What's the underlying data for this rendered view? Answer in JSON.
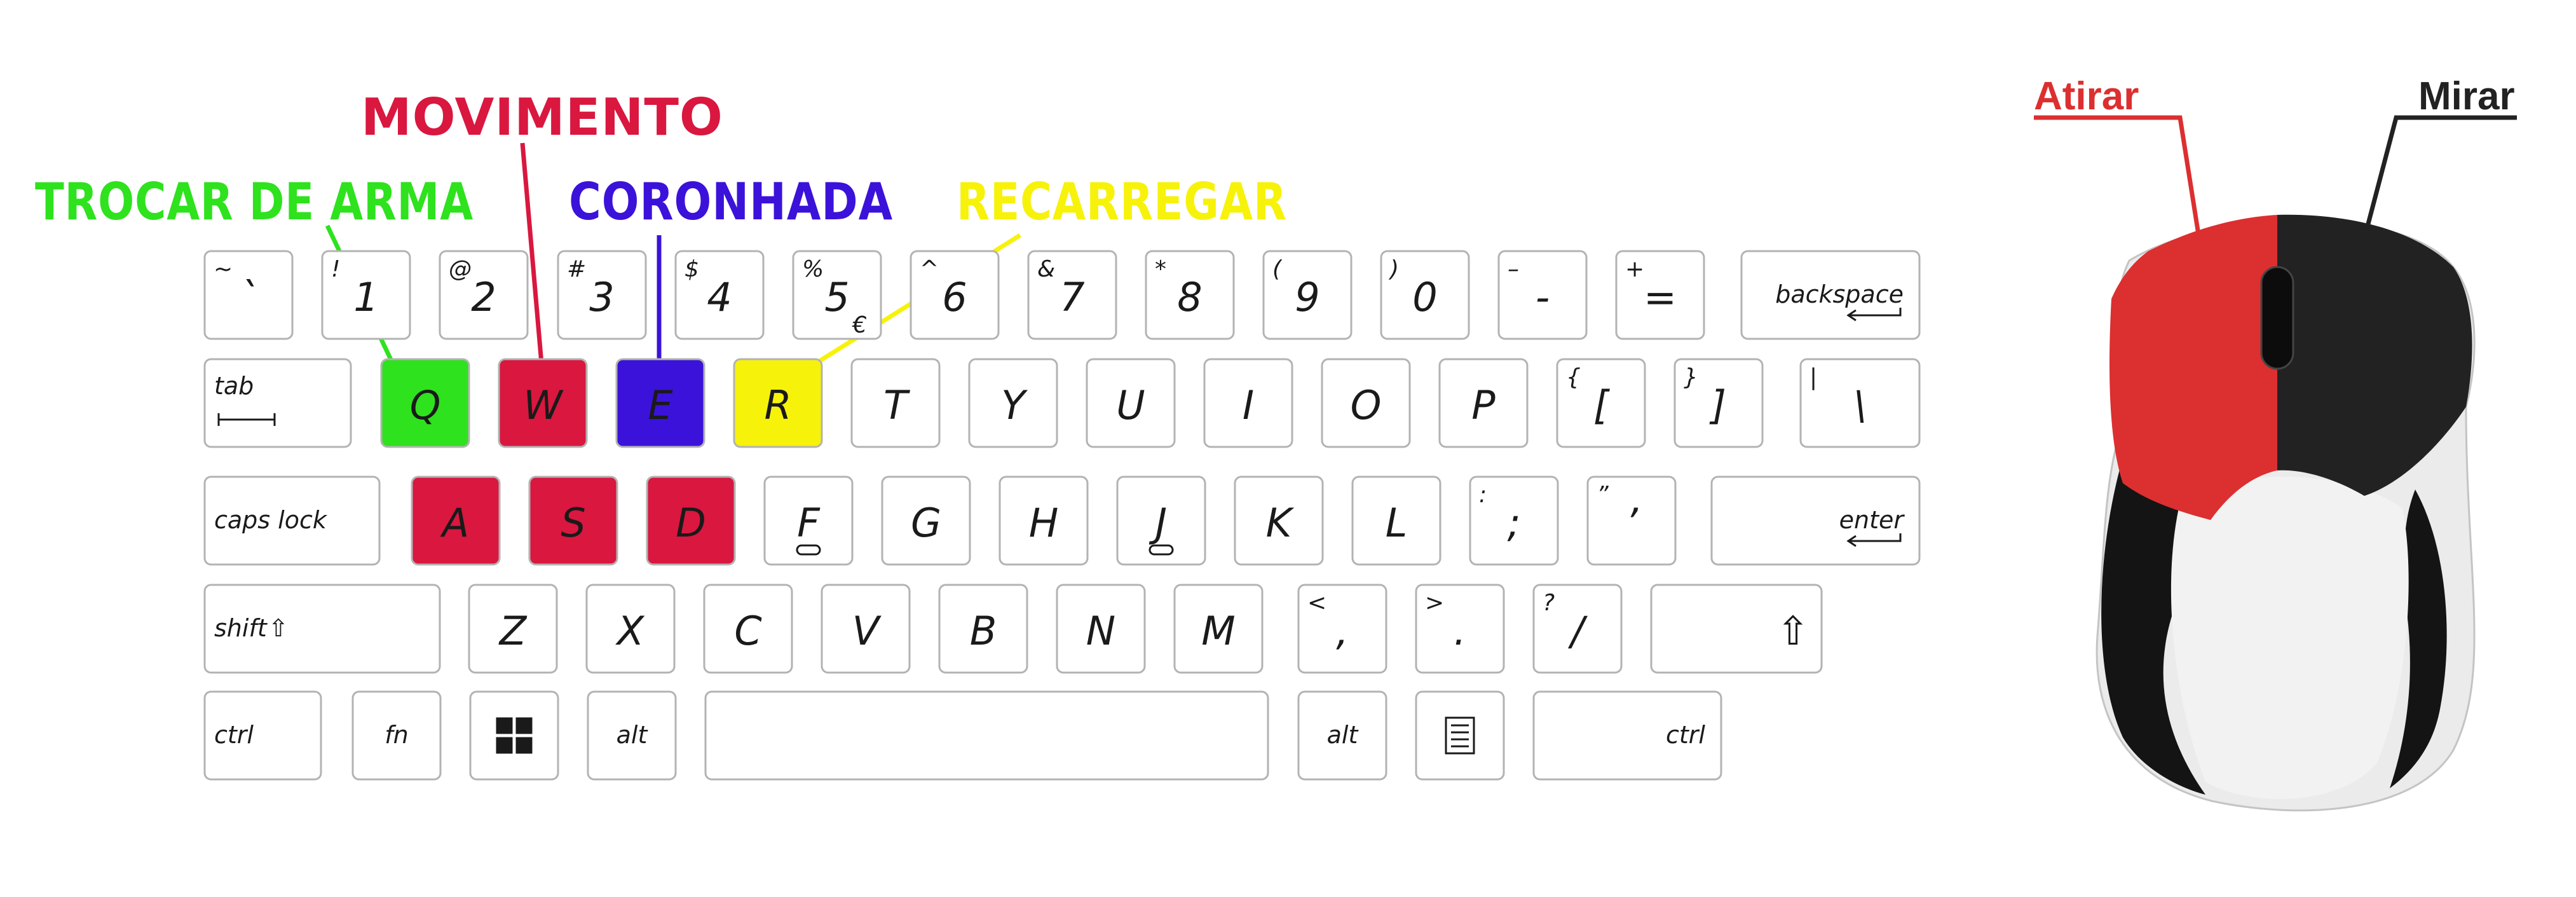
{
  "colors": {
    "green": "#2ee21e",
    "red": "#d9173f",
    "blue": "#3b12d9",
    "yellow": "#f7f20a",
    "mouse_red": "#dc2f30",
    "mouse_black": "#222222"
  },
  "callouts": {
    "movimento": "MOVIMENTO",
    "trocar_de_arma": "TROCAR DE ARMA",
    "coronhada": "CORONHADA",
    "recarregar": "RECARREGAR"
  },
  "mouse": {
    "left_button_label": "Atirar",
    "right_button_label": "Mirar"
  },
  "keyboard": {
    "number_row": [
      {
        "main": "ˋ",
        "shift": "~"
      },
      {
        "main": "1",
        "shift": "!"
      },
      {
        "main": "2",
        "shift": "@"
      },
      {
        "main": "3",
        "shift": "#"
      },
      {
        "main": "4",
        "shift": "$"
      },
      {
        "main": "5",
        "shift": "%",
        "alt": "€"
      },
      {
        "main": "6",
        "shift": "^"
      },
      {
        "main": "7",
        "shift": "&"
      },
      {
        "main": "8",
        "shift": "*"
      },
      {
        "main": "9",
        "shift": "("
      },
      {
        "main": "0",
        "shift": ")"
      },
      {
        "main": "-",
        "shift": "–"
      },
      {
        "main": "=",
        "shift": "+"
      },
      {
        "main": "backspace"
      }
    ],
    "top_row": [
      {
        "main": "tab"
      },
      {
        "main": "Q",
        "highlight": "green"
      },
      {
        "main": "W",
        "highlight": "red"
      },
      {
        "main": "E",
        "highlight": "blue"
      },
      {
        "main": "R",
        "highlight": "yellow"
      },
      {
        "main": "T"
      },
      {
        "main": "Y"
      },
      {
        "main": "U"
      },
      {
        "main": "I"
      },
      {
        "main": "O"
      },
      {
        "main": "P"
      },
      {
        "main": "[",
        "shift": "{"
      },
      {
        "main": "]",
        "shift": "}"
      },
      {
        "main": "\\",
        "shift": "|"
      }
    ],
    "home_row": [
      {
        "main": "caps lock"
      },
      {
        "main": "A",
        "highlight": "red"
      },
      {
        "main": "S",
        "highlight": "red"
      },
      {
        "main": "D",
        "highlight": "red"
      },
      {
        "main": "F"
      },
      {
        "main": "G"
      },
      {
        "main": "H"
      },
      {
        "main": "J"
      },
      {
        "main": "K"
      },
      {
        "main": "L"
      },
      {
        "main": ";",
        "shift": ":"
      },
      {
        "main": "’",
        "shift": "”"
      },
      {
        "main": "enter"
      }
    ],
    "bottom_row": [
      {
        "main": "shift"
      },
      {
        "main": "Z"
      },
      {
        "main": "X"
      },
      {
        "main": "C"
      },
      {
        "main": "V"
      },
      {
        "main": "B"
      },
      {
        "main": "N"
      },
      {
        "main": "M"
      },
      {
        "main": ",",
        "shift": "<"
      },
      {
        "main": ".",
        "shift": ">"
      },
      {
        "main": "/",
        "shift": "?"
      },
      {
        "main": "⇧"
      }
    ],
    "space_row": [
      {
        "main": "ctrl"
      },
      {
        "main": "fn"
      },
      {
        "main": "windows-icon"
      },
      {
        "main": "alt"
      },
      {
        "main": ""
      },
      {
        "main": "alt"
      },
      {
        "main": "menu-icon"
      },
      {
        "main": "ctrl"
      }
    ]
  }
}
